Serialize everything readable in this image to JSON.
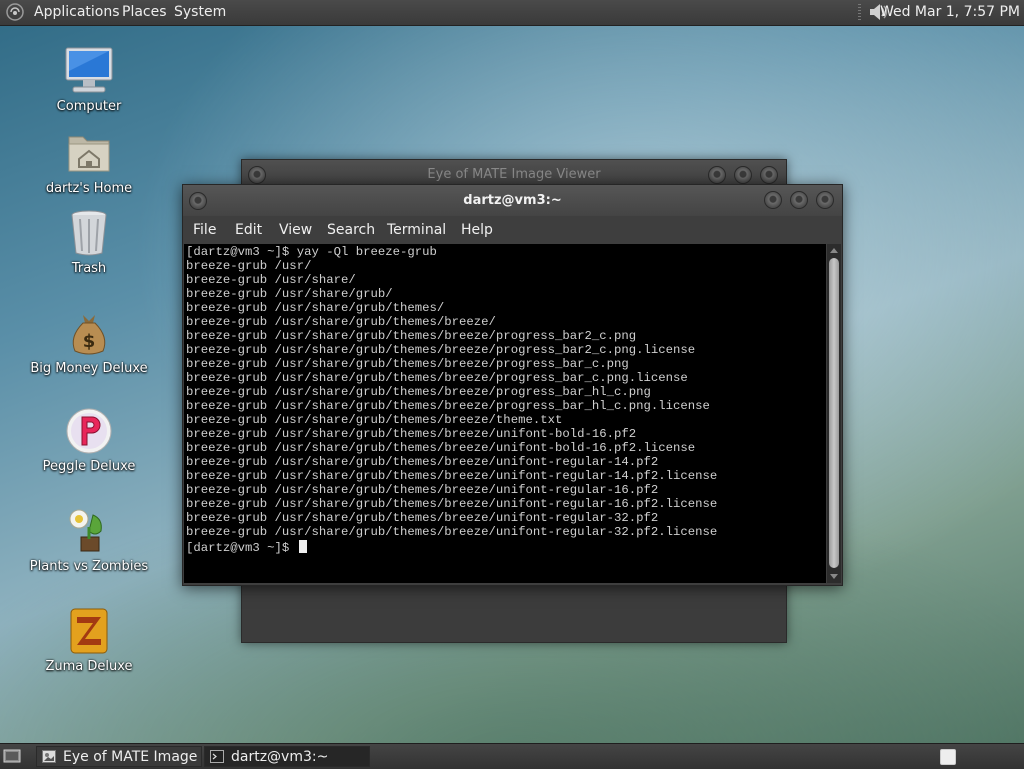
{
  "top_panel": {
    "menus": [
      "Applications",
      "Places",
      "System"
    ],
    "clock": "Wed Mar  1,  7:57 PM"
  },
  "desktop_icons": [
    {
      "label": "Computer",
      "icon": "computer-icon"
    },
    {
      "label": "dartz's Home",
      "icon": "home-folder-icon"
    },
    {
      "label": "Trash",
      "icon": "trash-icon"
    },
    {
      "label": "Big Money Deluxe",
      "icon": "money-bag-icon"
    },
    {
      "label": "Peggle Deluxe",
      "icon": "peggle-icon"
    },
    {
      "label": "Plants vs Zombies",
      "icon": "plants-vs-zombies-icon"
    },
    {
      "label": "Zuma Deluxe",
      "icon": "zuma-icon"
    }
  ],
  "background_window": {
    "title": "Eye of MATE Image Viewer"
  },
  "terminal": {
    "title": "dartz@vm3:~",
    "menus": [
      "File",
      "Edit",
      "View",
      "Search",
      "Terminal",
      "Help"
    ],
    "output": "[dartz@vm3 ~]$ yay -Ql breeze-grub\nbreeze-grub /usr/\nbreeze-grub /usr/share/\nbreeze-grub /usr/share/grub/\nbreeze-grub /usr/share/grub/themes/\nbreeze-grub /usr/share/grub/themes/breeze/\nbreeze-grub /usr/share/grub/themes/breeze/progress_bar2_c.png\nbreeze-grub /usr/share/grub/themes/breeze/progress_bar2_c.png.license\nbreeze-grub /usr/share/grub/themes/breeze/progress_bar_c.png\nbreeze-grub /usr/share/grub/themes/breeze/progress_bar_c.png.license\nbreeze-grub /usr/share/grub/themes/breeze/progress_bar_hl_c.png\nbreeze-grub /usr/share/grub/themes/breeze/progress_bar_hl_c.png.license\nbreeze-grub /usr/share/grub/themes/breeze/theme.txt\nbreeze-grub /usr/share/grub/themes/breeze/unifont-bold-16.pf2\nbreeze-grub /usr/share/grub/themes/breeze/unifont-bold-16.pf2.license\nbreeze-grub /usr/share/grub/themes/breeze/unifont-regular-14.pf2\nbreeze-grub /usr/share/grub/themes/breeze/unifont-regular-14.pf2.license\nbreeze-grub /usr/share/grub/themes/breeze/unifont-regular-16.pf2\nbreeze-grub /usr/share/grub/themes/breeze/unifont-regular-16.pf2.license\nbreeze-grub /usr/share/grub/themes/breeze/unifont-regular-32.pf2\nbreeze-grub /usr/share/grub/themes/breeze/unifont-regular-32.pf2.license",
    "prompt": "[dartz@vm3 ~]$ "
  },
  "taskbar": {
    "tasks": [
      "Eye of MATE Image ...",
      "dartz@vm3:~"
    ]
  }
}
